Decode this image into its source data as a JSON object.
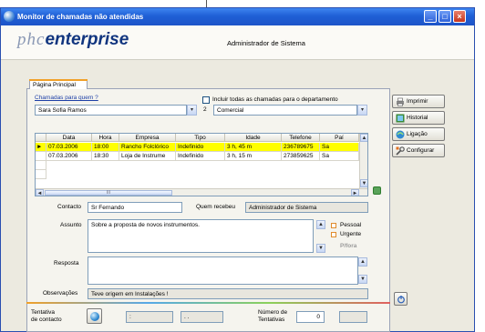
{
  "window": {
    "title": "Monitor de chamadas não atendidas",
    "controls": [
      "_",
      "□",
      "×"
    ]
  },
  "header": {
    "logo_phc": "phc",
    "logo_enterprise": "enterprise",
    "user": "Administrador de Sistema"
  },
  "tabs": [
    {
      "label": "Página Principal"
    }
  ],
  "filters": {
    "calls_for_label": "Chamadas para quem ?",
    "calls_for_value": "Sara Sofia Ramos",
    "include_dept_label": "Incluir todas as chamadas para o departamento",
    "dept_number": "2",
    "dept_value": "Comercial"
  },
  "calls_table": {
    "columns": [
      "Data",
      "Hora",
      "Empresa",
      "Tipo",
      "Idade",
      "Telefone",
      "Paí"
    ],
    "rows": [
      [
        "07.03.2006",
        "18:00",
        "Rancho Folclórico",
        "Indefinido",
        "3 h, 45 m",
        "236789675",
        "Sa"
      ],
      [
        "07.03.2006",
        "18:30",
        "Loja de Instrume",
        "Indefinido",
        "3 h, 15 m",
        "273859625",
        "Sa"
      ]
    ],
    "hscroll_mark": "III"
  },
  "details": {
    "contact_label": "Contacto",
    "contact_value": "Sr Fernando",
    "received_by_label": "Quem recebeu",
    "received_by_value": "Administrador de Sistema",
    "subject_label": "Assunto",
    "subject_value": "Sobre a proposta de novos instrumentos.",
    "personal_label": "Pessoal",
    "urgent_label": "Urgente",
    "pfora_label": "P/fora",
    "reply_label": "Resposta",
    "reply_value": "",
    "notes_label": "Observações",
    "notes_value": "Teve origem em Instalações !"
  },
  "footer": {
    "attempt_label_1": "Tentativa",
    "attempt_label_2": "de contacto",
    "time_value": ":",
    "date_value": ". .",
    "num_attempts_label_1": "Número de",
    "num_attempts_label_2": "Tentativas",
    "num_attempts_value": "0"
  },
  "side_buttons": [
    {
      "label": "Imprimir",
      "icon": "printer-icon"
    },
    {
      "label": "Historial",
      "icon": "history-icon"
    },
    {
      "label": "Ligação",
      "icon": "link-icon"
    },
    {
      "label": "Configurar",
      "icon": "wrench-icon"
    }
  ],
  "colors": {
    "titlebar": "#1f5fd6",
    "selected_row": "#ffff00",
    "tab_accent": "#f0a028",
    "logo_blue": "#11357f"
  }
}
